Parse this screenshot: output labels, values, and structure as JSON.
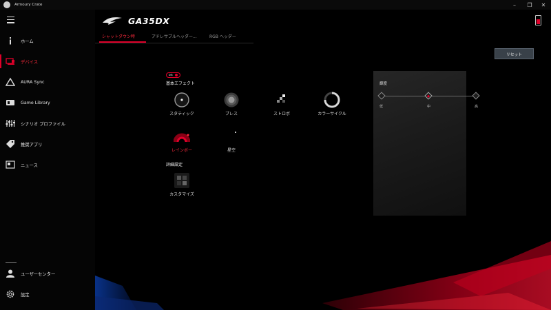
{
  "window": {
    "title": "Armoury Crate",
    "controls": [
      "–",
      "❐",
      "✕"
    ]
  },
  "sidebar": {
    "items": [
      {
        "label": "ホーム",
        "icon": "info-icon"
      },
      {
        "label": "デバイス",
        "icon": "device-icon",
        "active": true
      },
      {
        "label": "AURA Sync",
        "icon": "aura-icon"
      },
      {
        "label": "Game Library",
        "icon": "game-library-icon"
      },
      {
        "label": "シナリオ プロファイル",
        "icon": "sliders-icon"
      },
      {
        "label": "推奨アプリ",
        "icon": "tag-icon"
      },
      {
        "label": "ニュース",
        "icon": "news-icon"
      }
    ],
    "bottom_items": [
      {
        "label": "ユーザーセンター",
        "icon": "user-icon"
      },
      {
        "label": "設定",
        "icon": "gear-icon"
      }
    ]
  },
  "device": {
    "name": "GA35DX"
  },
  "tabs": [
    {
      "label": "シャットダウン時",
      "active": true
    },
    {
      "label": "アドレサブルヘッダー..."
    },
    {
      "label": "RGB ヘッダー"
    }
  ],
  "reset_label": "リセット",
  "toggle": {
    "label": "on",
    "state": "on"
  },
  "basic_effects": {
    "title": "基本エフェクト",
    "items": [
      {
        "label": "スタティック",
        "icon": "static-icon"
      },
      {
        "label": "ブレス",
        "icon": "breathing-icon"
      },
      {
        "label": "ストロボ",
        "icon": "strobe-icon"
      },
      {
        "label": "カラーサイクル",
        "icon": "color-cycle-icon"
      },
      {
        "label": "レインボー",
        "icon": "rainbow-icon",
        "selected": true
      },
      {
        "label": "星空",
        "icon": "starry-night-icon"
      }
    ]
  },
  "advanced": {
    "title": "詳細設定",
    "items": [
      {
        "label": "カスタマイズ",
        "icon": "customize-icon"
      }
    ]
  },
  "brightness": {
    "title": "輝度",
    "levels": [
      "低",
      "中",
      "高"
    ],
    "selected": "中"
  },
  "colors": {
    "accent": "#e0002a",
    "background": "#000000",
    "panel": "#1e1e1e"
  }
}
